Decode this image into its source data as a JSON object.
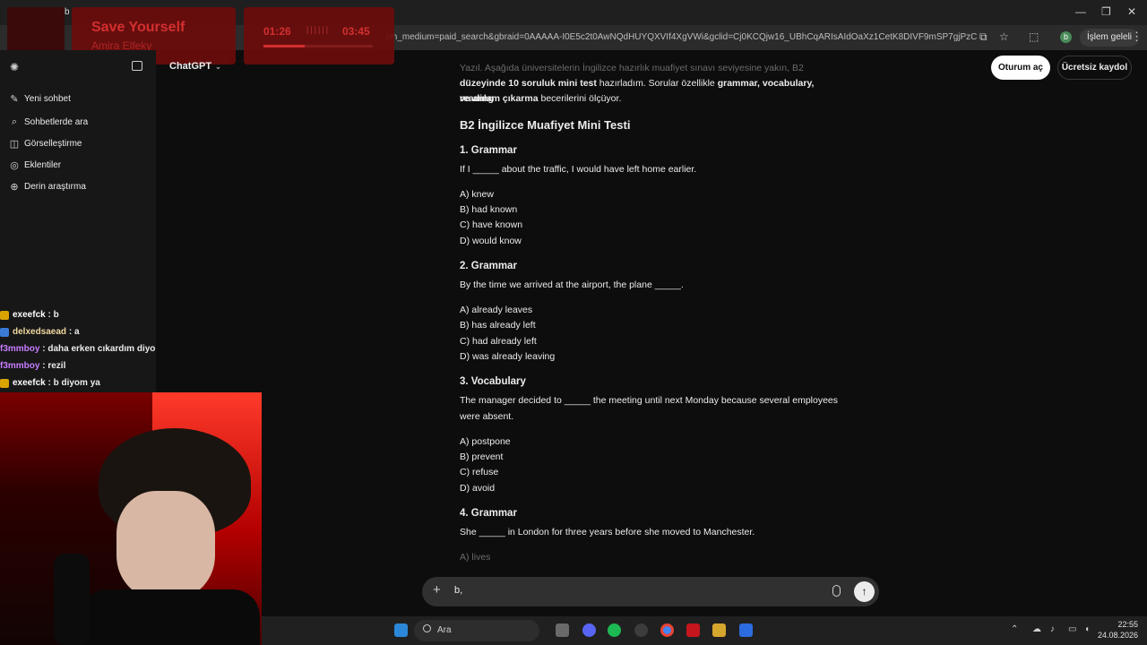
{
  "browser": {
    "tab_partial": "b",
    "address_url": "zm_medium=paid_search&gbraid=0AAAAA-I0E5c2t0AwNQdHUYQXVIf4XgVWi&gclid=Cj0KCQjw16_UBhCqARIsAIdOaXz1CetK8DIVF9mSP7gjPzC4bgXvY3G...",
    "profile_initial": "b",
    "paused_label": "İşlem geleli"
  },
  "music": {
    "title": "Save Yourself",
    "artist": "Amira Elfeky",
    "elapsed": "01:26",
    "total": "03:45",
    "dots": "||||||",
    "progress": 0.38
  },
  "sidebar": {
    "items": [
      {
        "icon": "✎",
        "label": "Yeni sohbet"
      },
      {
        "icon": "⌕",
        "label": "Sohbetlerde ara"
      },
      {
        "icon": "◫",
        "label": "Görselleştirme"
      },
      {
        "icon": "◎",
        "label": "Eklentiler"
      },
      {
        "icon": "⊕",
        "label": "Derin araştırma"
      }
    ]
  },
  "chat": [
    {
      "user": "exeefck",
      "msg": "b",
      "color": "#ffffff"
    },
    {
      "user": "delxedsaead",
      "msg": "a",
      "color": "#f0d7a0"
    },
    {
      "user": "f3mmboy",
      "msg": "daha erken cıkardım diyo",
      "color": "#c77dff"
    },
    {
      "user": "f3mmboy",
      "msg": "rezil",
      "color": "#c77dff"
    },
    {
      "user": "exeefck",
      "msg": "b diyom ya",
      "color": "#ffffff"
    }
  ],
  "header": {
    "title": "ChatGPT",
    "login": "Oturum aç",
    "signup": "Ücretsiz kaydol"
  },
  "doc": {
    "intro_faded": "Yazıl. Aşağıda üniversitelerin İngilizce hazırlık muafiyet sınavı seviyesine yakın, B2",
    "intro_b1": "düzeyinde 10 soruluk mini test",
    "intro_t1": " hazırladım. Sorular özellikle ",
    "intro_b2": "grammar, vocabulary, reading",
    "intro_b3": "ve anlam çıkarma",
    "intro_t2": " becerilerini ölçüyor.",
    "test_title": "B2 İngilizce Muafiyet Mini Testi",
    "q1_h": "1. Grammar",
    "q1_text": "If I _____ about the traffic, I would have left home earlier.",
    "q1_a": "A) knew",
    "q1_b": "B) had known",
    "q1_c": "C) have known",
    "q1_d": "D) would know",
    "q2_h": "2. Grammar",
    "q2_text": "By the time we arrived at the airport, the plane _____.",
    "q2_a": "A) already leaves",
    "q2_b": "B) has already left",
    "q2_c": "C) had already left",
    "q2_d": "D) was already leaving",
    "q3_h": "3. Vocabulary",
    "q3_text1": "The manager decided to _____ the meeting until next Monday because several employees",
    "q3_text2": "were absent.",
    "q3_a": "A) postpone",
    "q3_b": "B) prevent",
    "q3_c": "C) refuse",
    "q3_d": "D) avoid",
    "q4_h": "4. Grammar",
    "q4_text": "She _____ in London for three years before she moved to Manchester.",
    "q4_a": "A) lives"
  },
  "composer": {
    "text": "b,"
  },
  "taskbar": {
    "search": "Ara",
    "time": "22:55",
    "date": "24.08.2026"
  }
}
